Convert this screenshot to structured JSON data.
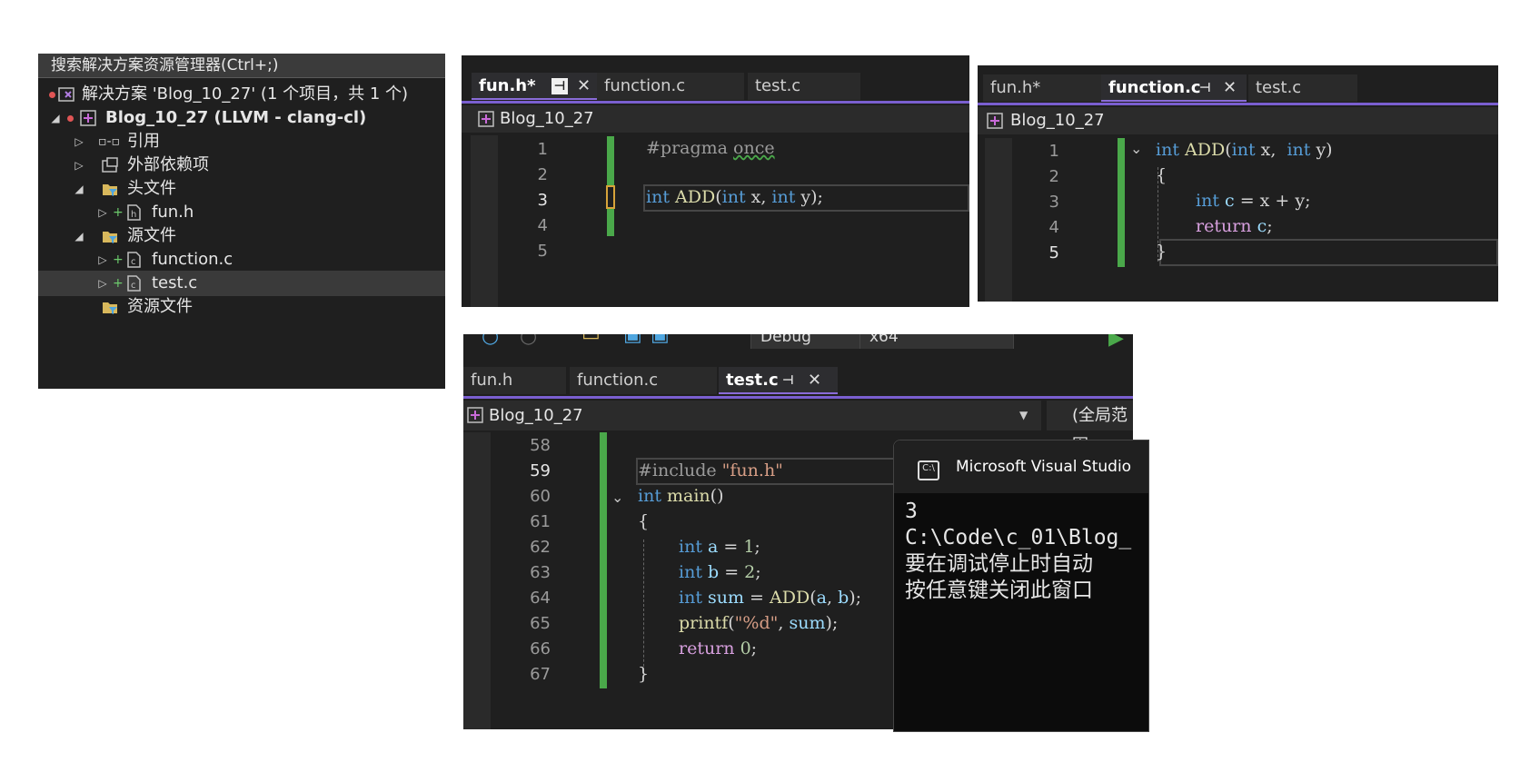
{
  "solution_explorer": {
    "search_label": "搜索解决方案资源管理器(Ctrl+;)",
    "solution": "解决方案 'Blog_10_27' (1 个项目，共 1 个)",
    "project": "Blog_10_27 (LLVM - clang-cl)",
    "references": "引用",
    "external_deps": "外部依赖项",
    "header_files": "头文件",
    "fun_h": "fun.h",
    "source_files": "源文件",
    "function_c": "function.c",
    "test_c": "test.c",
    "resource_files": "资源文件"
  },
  "editor1": {
    "tabs": [
      "fun.h*",
      "function.c",
      "test.c"
    ],
    "nav": "Blog_10_27",
    "lines": [
      "1",
      "2",
      "3",
      "4",
      "5"
    ]
  },
  "editor2": {
    "tabs": [
      "fun.h*",
      "function.c",
      "test.c"
    ],
    "nav": "Blog_10_27",
    "lines": [
      "1",
      "2",
      "3",
      "4",
      "5"
    ]
  },
  "editor3": {
    "toolbar": {
      "config": "Debug",
      "platform": "x64"
    },
    "tabs": [
      "fun.h",
      "function.c",
      "test.c"
    ],
    "nav": "Blog_10_27",
    "scope": "(全局范围",
    "lines": [
      "58",
      "59",
      "60",
      "61",
      "62",
      "63",
      "64",
      "65",
      "66",
      "67"
    ]
  },
  "console": {
    "title": "Microsoft Visual Studio",
    "out": [
      "3",
      "C:\\Code\\c_01\\Blog_",
      "要在调试停止时自动",
      "按任意键关闭此窗口"
    ]
  }
}
